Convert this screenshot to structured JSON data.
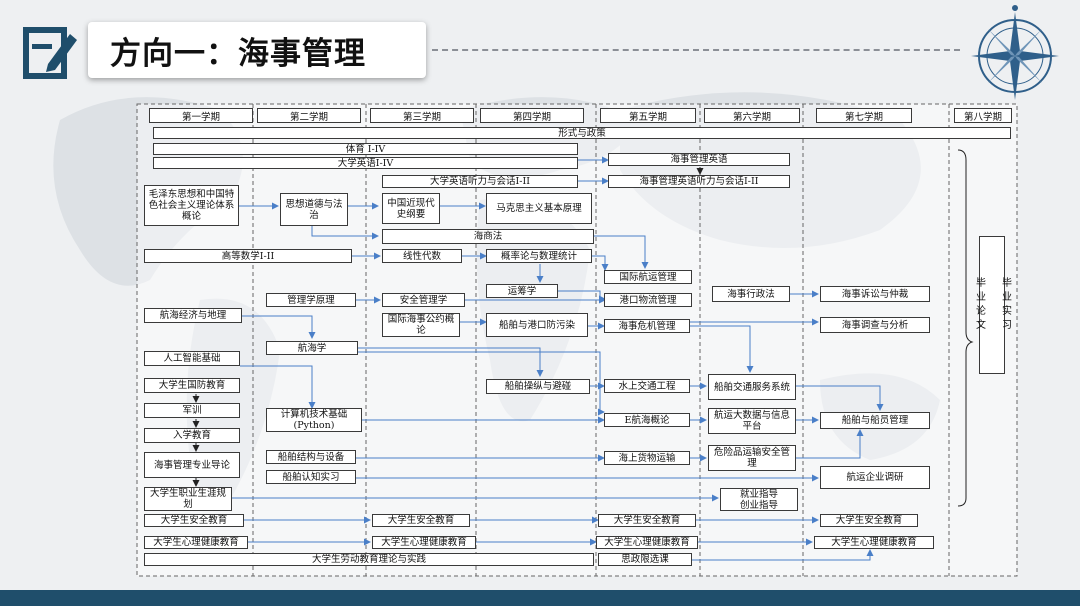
{
  "slide": {
    "title": "方向一：海事管理",
    "icons": {
      "left": "edit-document-icon",
      "right": "compass-rose-icon"
    },
    "colors": {
      "accent": "#1f4e6b",
      "arrow": "#4a7fc8",
      "border": "#3a3a3a"
    }
  },
  "semesters": [
    "第一学期",
    "第二学期",
    "第三学期",
    "第四学期",
    "第五学期",
    "第六学期",
    "第七学期",
    "第八学期"
  ],
  "courses": {
    "xingshi": "形式与政策",
    "tiyu": "体育 I-IV",
    "yingyu": "大学英语I-IV",
    "tingli": "大学英语听力与会话I-II",
    "hs_yingyu": "海事管理英语",
    "hs_tingli": "海事管理英语听力与会话I-II",
    "mao": "毛泽东思想和中国特色社会主义理论体系概论",
    "sixiang": "思想道德与法治",
    "jindai": "中国近现代史纲要",
    "makesi": "马克思主义基本原理",
    "haishang": "海商法",
    "gaoshu": "高等数学I-II",
    "xiandai": "线性代数",
    "gailv": "概率论与数理统计",
    "hangyun": "国际航运管理",
    "yunchou": "运筹学",
    "gangkou": "港口物流管理",
    "guanli": "管理学原理",
    "anquan": "安全管理学",
    "xingzheng": "海事行政法",
    "susong": "海事诉讼与仲裁",
    "jingji": "航海经济与地理",
    "gongyue": "国际海事公约概论",
    "wuran": "船舶与港口防污染",
    "weiji": "海事危机管理",
    "diaocha": "海事调查与分析",
    "hanghaixue": "航海学",
    "rengong": "人工智能基础",
    "caozong": "船舶操纵与避碰",
    "shuishang": "水上交通工程",
    "jiaotong": "船舶交通服务系统",
    "guofang": "大学生国防教育",
    "junxun": "军训",
    "jisuanji": "计算机技术基础\n(Python)",
    "ehanghai": "E航海概论",
    "dashuju": "航运大数据与信息平台",
    "chuanyuan": "船舶与船员管理",
    "ruxue": "入学教育",
    "daolun": "海事管理专业导论",
    "jiegou": "船舶结构与设备",
    "huowu": "海上货物运输",
    "weixian": "危险品运输安全管理",
    "renzhi": "船舶认知实习",
    "diaoyan": "航运企业调研",
    "zhiye": "大学生职业生涯规划",
    "jiuye": "就业指导\n创业指导",
    "anjiao1": "大学生安全教育",
    "anjiao3": "大学生安全教育",
    "anjiao5": "大学生安全教育",
    "anjiao7": "大学生安全教育",
    "xinli1": "大学生心理健康教育",
    "xinli3": "大学生心理健康教育",
    "xinli5": "大学生心理健康教育",
    "xinli7": "大学生心理健康教育",
    "laodong": "大学生劳动教育理论与实践",
    "sizheng": "思政限选课",
    "biye": "毕业实习\n\n毕业论文"
  }
}
